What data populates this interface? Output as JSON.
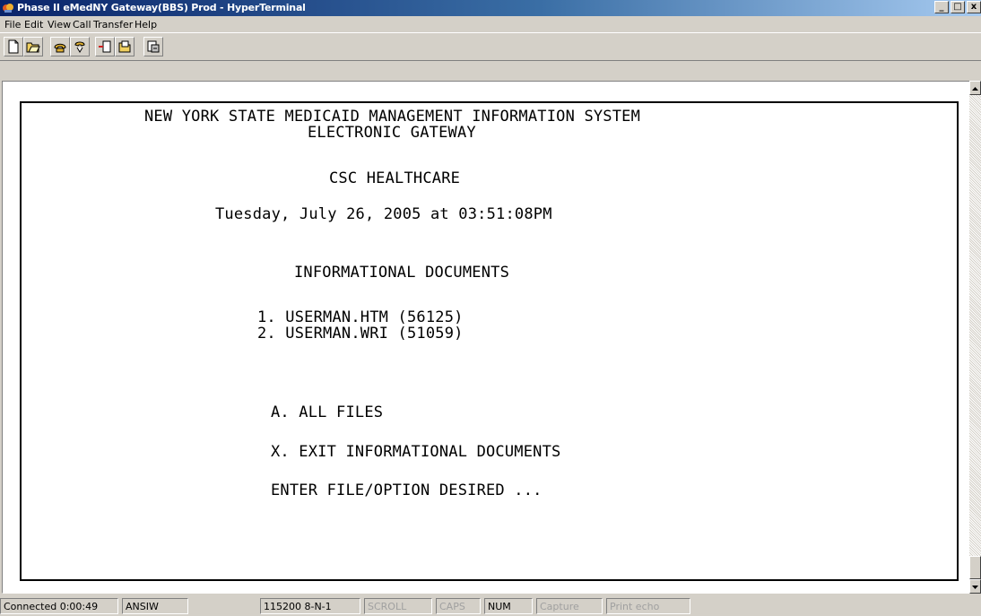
{
  "window": {
    "title": "Phase II eMedNY Gateway(BBS) Prod - HyperTerminal",
    "controls": {
      "minimize": "_",
      "maximize": "□",
      "close": "x"
    }
  },
  "menu": [
    "File",
    "Edit",
    "View",
    "Call",
    "Transfer",
    "Help"
  ],
  "toolbar": [
    "new-icon",
    "open-icon",
    "connect-icon",
    "disconnect-icon",
    "send-icon",
    "receive-icon",
    "properties-icon"
  ],
  "terminal": {
    "header_line1": "NEW YORK STATE MEDICAID MANAGEMENT INFORMATION SYSTEM",
    "header_line2": "ELECTRONIC GATEWAY",
    "company": "CSC HEALTHCARE",
    "datetime": "Tuesday, July 26, 2005 at 03:51:08PM",
    "section_title": "INFORMATIONAL DOCUMENTS",
    "files": [
      "1. USERMAN.HTM (56125)",
      "2. USERMAN.WRI (51059)"
    ],
    "option_all": "A. ALL FILES",
    "option_exit": "X. EXIT INFORMATIONAL DOCUMENTS",
    "prompt": "ENTER FILE/OPTION DESIRED ..."
  },
  "status": {
    "connected": "Connected 0:00:49",
    "emulation": "ANSIW",
    "port": "115200 8-N-1",
    "scroll": "SCROLL",
    "caps": "CAPS",
    "num": "NUM",
    "capture": "Capture",
    "print_echo": "Print echo"
  }
}
